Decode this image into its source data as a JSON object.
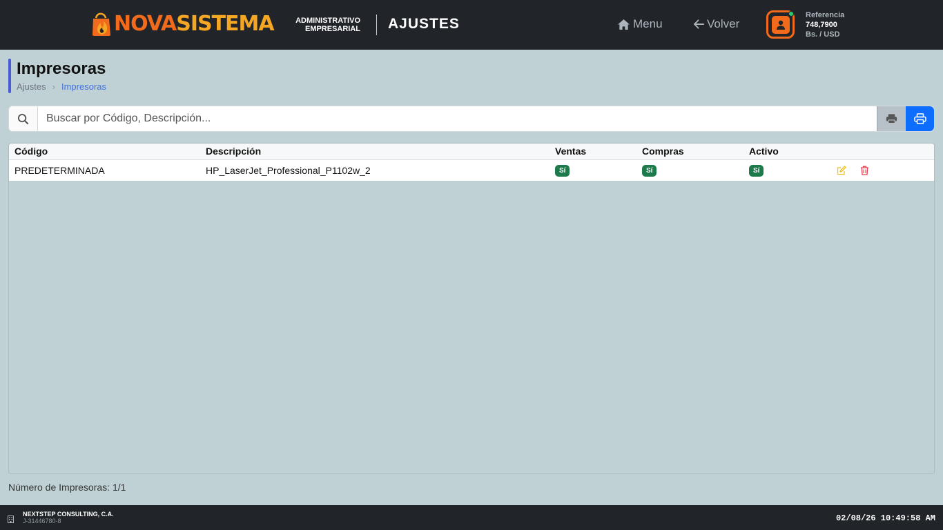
{
  "header": {
    "brand_part1": "NOVA",
    "brand_part2": "SISTEMA",
    "tagline_line1": "ADMINISTRATIVO",
    "tagline_line2": "EMPRESARIAL",
    "section": "AJUSTES",
    "menu_label": "Menu",
    "back_label": "Volver",
    "reference_label": "Referencia",
    "reference_value": "748,7900",
    "reference_unit": "Bs. / USD",
    "icons": [
      "flame-bag-logo-icon",
      "home-icon",
      "arrow-left-icon",
      "user-icon"
    ]
  },
  "page": {
    "title": "Impresoras",
    "breadcrumb": [
      "Ajustes",
      "Impresoras"
    ]
  },
  "search": {
    "placeholder": "Buscar por Código, Descripción...",
    "value": ""
  },
  "table": {
    "columns": [
      "Código",
      "Descripción",
      "Ventas",
      "Compras",
      "Activo"
    ],
    "rows": [
      {
        "codigo": "PREDETERMINADA",
        "descripcion": "HP_LaserJet_Professional_P1102w_2",
        "ventas": "Sí",
        "compras": "Sí",
        "activo": "Sí"
      }
    ]
  },
  "count_text": "Número de Impresoras: 1/1",
  "footer": {
    "company": "NEXTSTEP CONSULTING, C.A.",
    "rif": "J-31446780-8",
    "datetime": "02/08/26 10:49:58 AM"
  },
  "colors": {
    "accent_orange": "#f26a1b",
    "brand_yellow": "#f5a623",
    "primary_blue": "#0d6efd",
    "badge_green": "#1d7a4b",
    "dark_bar": "#212529",
    "background": "#c0d1d6"
  }
}
